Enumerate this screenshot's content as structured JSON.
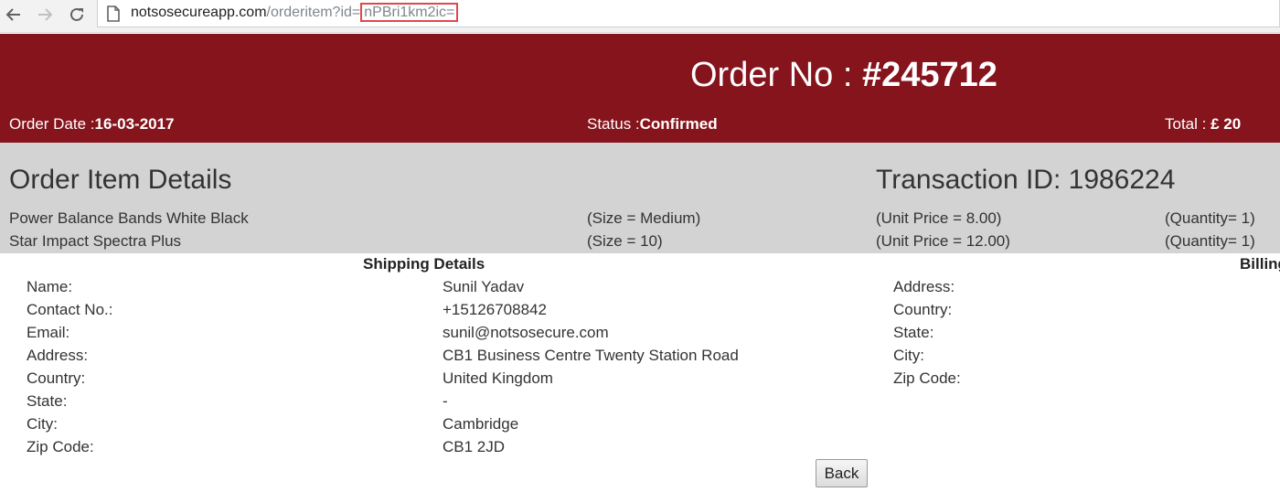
{
  "browser": {
    "url_host": "notsosecureapp.com",
    "url_path": "/orderitem?id=",
    "url_param": "nPBri1km2ic="
  },
  "header": {
    "order_label": "Order No : ",
    "order_number": "#245712",
    "order_date_label": "Order Date :",
    "order_date": "16-03-2017",
    "status_label": "Status :",
    "status": "Confirmed",
    "total_label": "Total : ",
    "total": "£ 20"
  },
  "items": {
    "title": "Order Item Details",
    "transaction": "Transaction ID: 1986224",
    "rows": [
      {
        "name": "Power Balance Bands White Black",
        "size": "(Size = Medium)",
        "price": "(Unit Price = 8.00)",
        "qty": "(Quantity= 1)"
      },
      {
        "name": "Star Impact Spectra Plus",
        "size": "(Size = 10)",
        "price": "(Unit Price = 12.00)",
        "qty": "(Quantity= 1)"
      }
    ]
  },
  "shipping": {
    "heading": "Shipping Details",
    "rows": [
      {
        "label": "Name:",
        "value": "Sunil Yadav"
      },
      {
        "label": "Contact No.:",
        "value": "+15126708842"
      },
      {
        "label": "Email:",
        "value": "sunil@notsosecure.com"
      },
      {
        "label": "Address:",
        "value": "CB1 Business Centre Twenty Station Road"
      },
      {
        "label": "Country:",
        "value": "United Kingdom"
      },
      {
        "label": "State:",
        "value": "-"
      },
      {
        "label": "City:",
        "value": "Cambridge"
      },
      {
        "label": "Zip Code:",
        "value": "CB1 2JD"
      }
    ]
  },
  "billing": {
    "heading": "Billing",
    "labels": [
      "Address:",
      "Country:",
      "State:",
      "City:",
      "Zip Code:"
    ]
  },
  "back_button": "Back",
  "icons": {
    "back": "arrow-left-icon",
    "forward": "arrow-right-icon",
    "reload": "reload-icon",
    "page": "page-icon"
  },
  "colors": {
    "header_bg": "#85141c",
    "panel_bg": "#d3d3d3",
    "highlight": "#e0484f"
  }
}
